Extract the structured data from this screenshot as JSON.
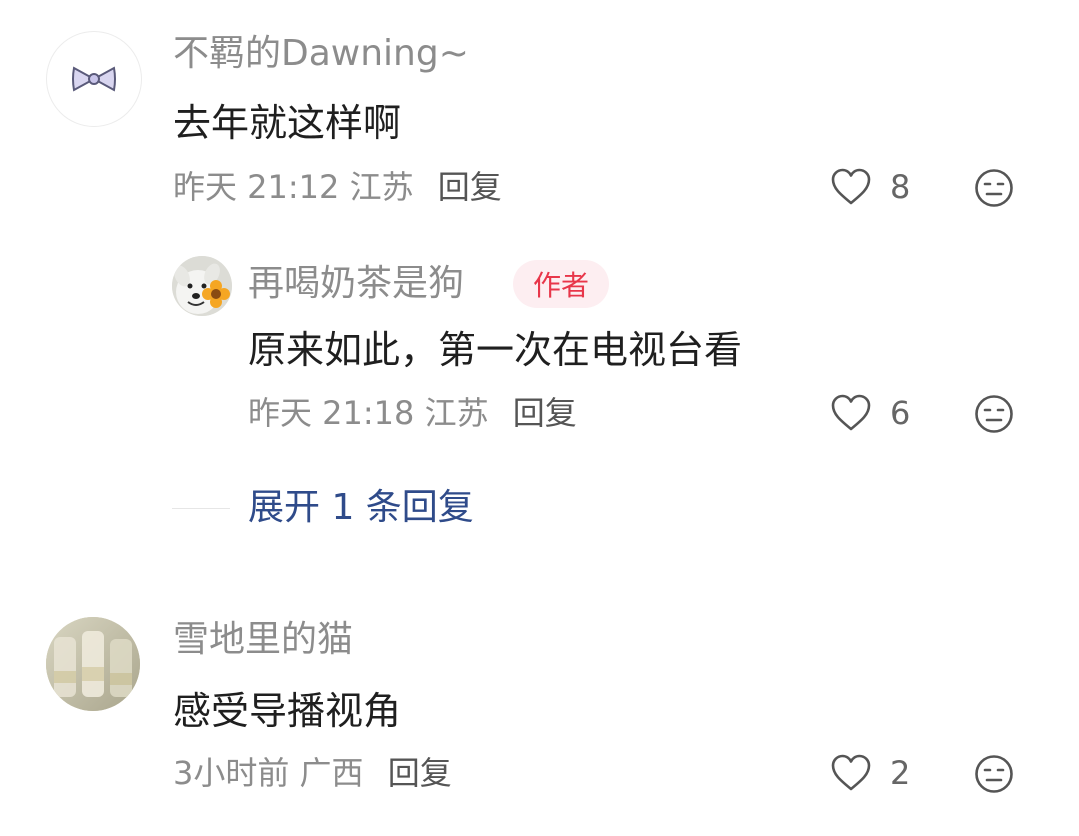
{
  "comments": [
    {
      "username": "不羁的Dawning~",
      "avatar_icon": "bow-tie-icon",
      "content": "去年就这样啊",
      "time": "昨天 21:12",
      "location": "江苏",
      "reply_label": "回复",
      "like_count": "8",
      "reply": {
        "username": "再喝奶茶是狗",
        "avatar_icon": "dog-with-flower-icon",
        "badge": "作者",
        "content": "原来如此，第一次在电视台看",
        "time": "昨天 21:18",
        "location": "江苏",
        "reply_label": "回复",
        "like_count": "6"
      },
      "expand_label": "展开 1 条回复"
    },
    {
      "username": "雪地里的猫",
      "avatar_icon": "glass-cups-photo-icon",
      "content": "感受导播视角",
      "time": "3小时前",
      "location": "广西",
      "reply_label": "回复",
      "like_count": "2"
    }
  ],
  "colors": {
    "username": "#8c8c8c",
    "content": "#1f1f1f",
    "badge_bg": "#fdeef1",
    "badge_text": "#e8364a",
    "expand_text": "#2f4b8a"
  }
}
